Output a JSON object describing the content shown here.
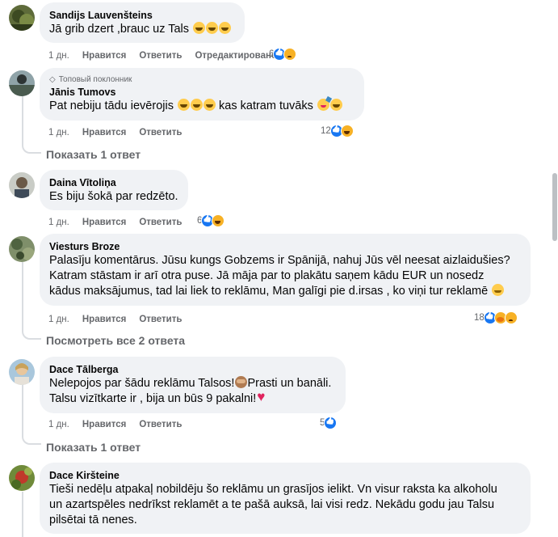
{
  "comments": [
    {
      "author": "Sandijs Lauvenšteins",
      "text": "Jā grib dzert ,brauc uz Tals",
      "time": "1 дн.",
      "like": "Нравится",
      "reply": "Ответить",
      "edited": "Отредактировано",
      "reaction_count": "6",
      "reactions": [
        "like-icon",
        "sad-icon"
      ]
    },
    {
      "badge": "Топовый поклонник",
      "author": "Jānis Tumovs",
      "text": "Pat nebiju tādu ievērojis",
      "text2": "kas katram tuvāks",
      "time": "1 дн.",
      "like": "Нравится",
      "reply": "Ответить",
      "reaction_count": "12",
      "reactions": [
        "like-icon",
        "haha-icon"
      ],
      "replies_link": "Показать 1 ответ"
    },
    {
      "author": "Daina Vītoliņa",
      "text": "Es biju šokā par redzēto.",
      "time": "1 дн.",
      "like": "Нравится",
      "reply": "Ответить",
      "reaction_count": "6",
      "reactions": [
        "like-icon",
        "haha-icon"
      ]
    },
    {
      "author": "Viesturs Broze",
      "text": "Palasīju komentārus. Jūsu kungs Gobzems ir Spānijā, nahuj Jūs vēl neesat aizlaidušies?\nKatram stāstam ir arī otra puse. Jā māja par to plakātu saņem kādu EUR un nosedz\nkādus maksājumus, tad lai liek to reklāmu, Man galīgi pie d.irsas , ko viņi tur reklamē",
      "time": "1 дн.",
      "like": "Нравится",
      "reply": "Ответить",
      "reaction_count": "18",
      "reactions": [
        "like-icon",
        "care-icon",
        "sad-icon"
      ],
      "replies_link": "Посмотреть все 2 ответа"
    },
    {
      "author": "Dace Tālberga",
      "text": "Nelepojos par šādu reklāmu Talsos!",
      "text_b": "Prasti un banāli.",
      "text2": "Talsu vizītkarte ir , bija un būs 9 pakalni!",
      "time": "1 дн.",
      "like": "Нравится",
      "reply": "Ответить",
      "reaction_count": "5",
      "reactions": [
        "like-icon"
      ],
      "replies_link": "Показать 1 ответ"
    },
    {
      "author": "Dace Kiršteine",
      "text": "Tieši nedēļu atpakaļ nobildēju šo reklāmu un grasījos ielikt. Vn visur raksta ka alkoholu\nun azartspēles nedrīkst reklamēt a te pašā auksā, lai visi redz. Nekādu godu jau Talsu\npilsētai tā nenes."
    }
  ]
}
